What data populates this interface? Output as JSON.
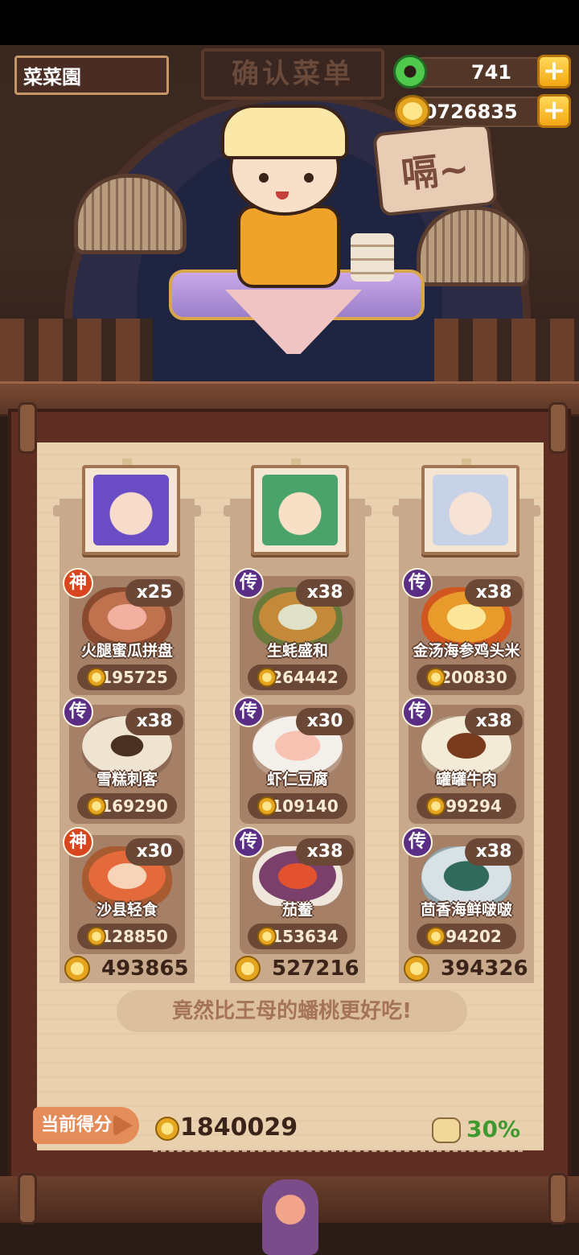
{
  "header": {
    "player_name": "菜菜園",
    "sign_text": "确认菜单",
    "jade_count": "741",
    "coin_count": "10726835",
    "speech": "嗝~"
  },
  "columns": [
    {
      "chef": "chef-1",
      "total": "493865",
      "dishes": [
        {
          "rank": "神",
          "qty": "x25",
          "name": "火腿蜜瓜拼盘",
          "price": "195725"
        },
        {
          "rank": "传",
          "qty": "x38",
          "name": "雪糕刺客",
          "price": "169290"
        },
        {
          "rank": "神",
          "qty": "x30",
          "name": "沙县轻食",
          "price": "128850"
        }
      ]
    },
    {
      "chef": "chef-2",
      "total": "527216",
      "dishes": [
        {
          "rank": "传",
          "qty": "x38",
          "name": "生蚝盛和",
          "price": "264442"
        },
        {
          "rank": "传",
          "qty": "x30",
          "name": "虾仁豆腐",
          "price": "109140"
        },
        {
          "rank": "传",
          "qty": "x38",
          "name": "茄鲞",
          "price": "153634"
        }
      ]
    },
    {
      "chef": "chef-3",
      "total": "394326",
      "dishes": [
        {
          "rank": "传",
          "qty": "x38",
          "name": "金汤海参鸡头米",
          "price": "200830"
        },
        {
          "rank": "传",
          "qty": "x38",
          "name": "罐罐牛肉",
          "price": "99294"
        },
        {
          "rank": "传",
          "qty": "x38",
          "name": "茴香海鲜啵啵",
          "price": "94202"
        }
      ]
    }
  ],
  "comment": "竟然比王母的蟠桃更好吃!",
  "score": {
    "label": "当前得分",
    "value": "1840029",
    "bonus": "30%"
  },
  "colors": {
    "god_rank": "#d9451f",
    "legend_rank": "#5b2e86",
    "bonus_green": "#3e9a2f",
    "accent_gold": "#f3a714"
  }
}
